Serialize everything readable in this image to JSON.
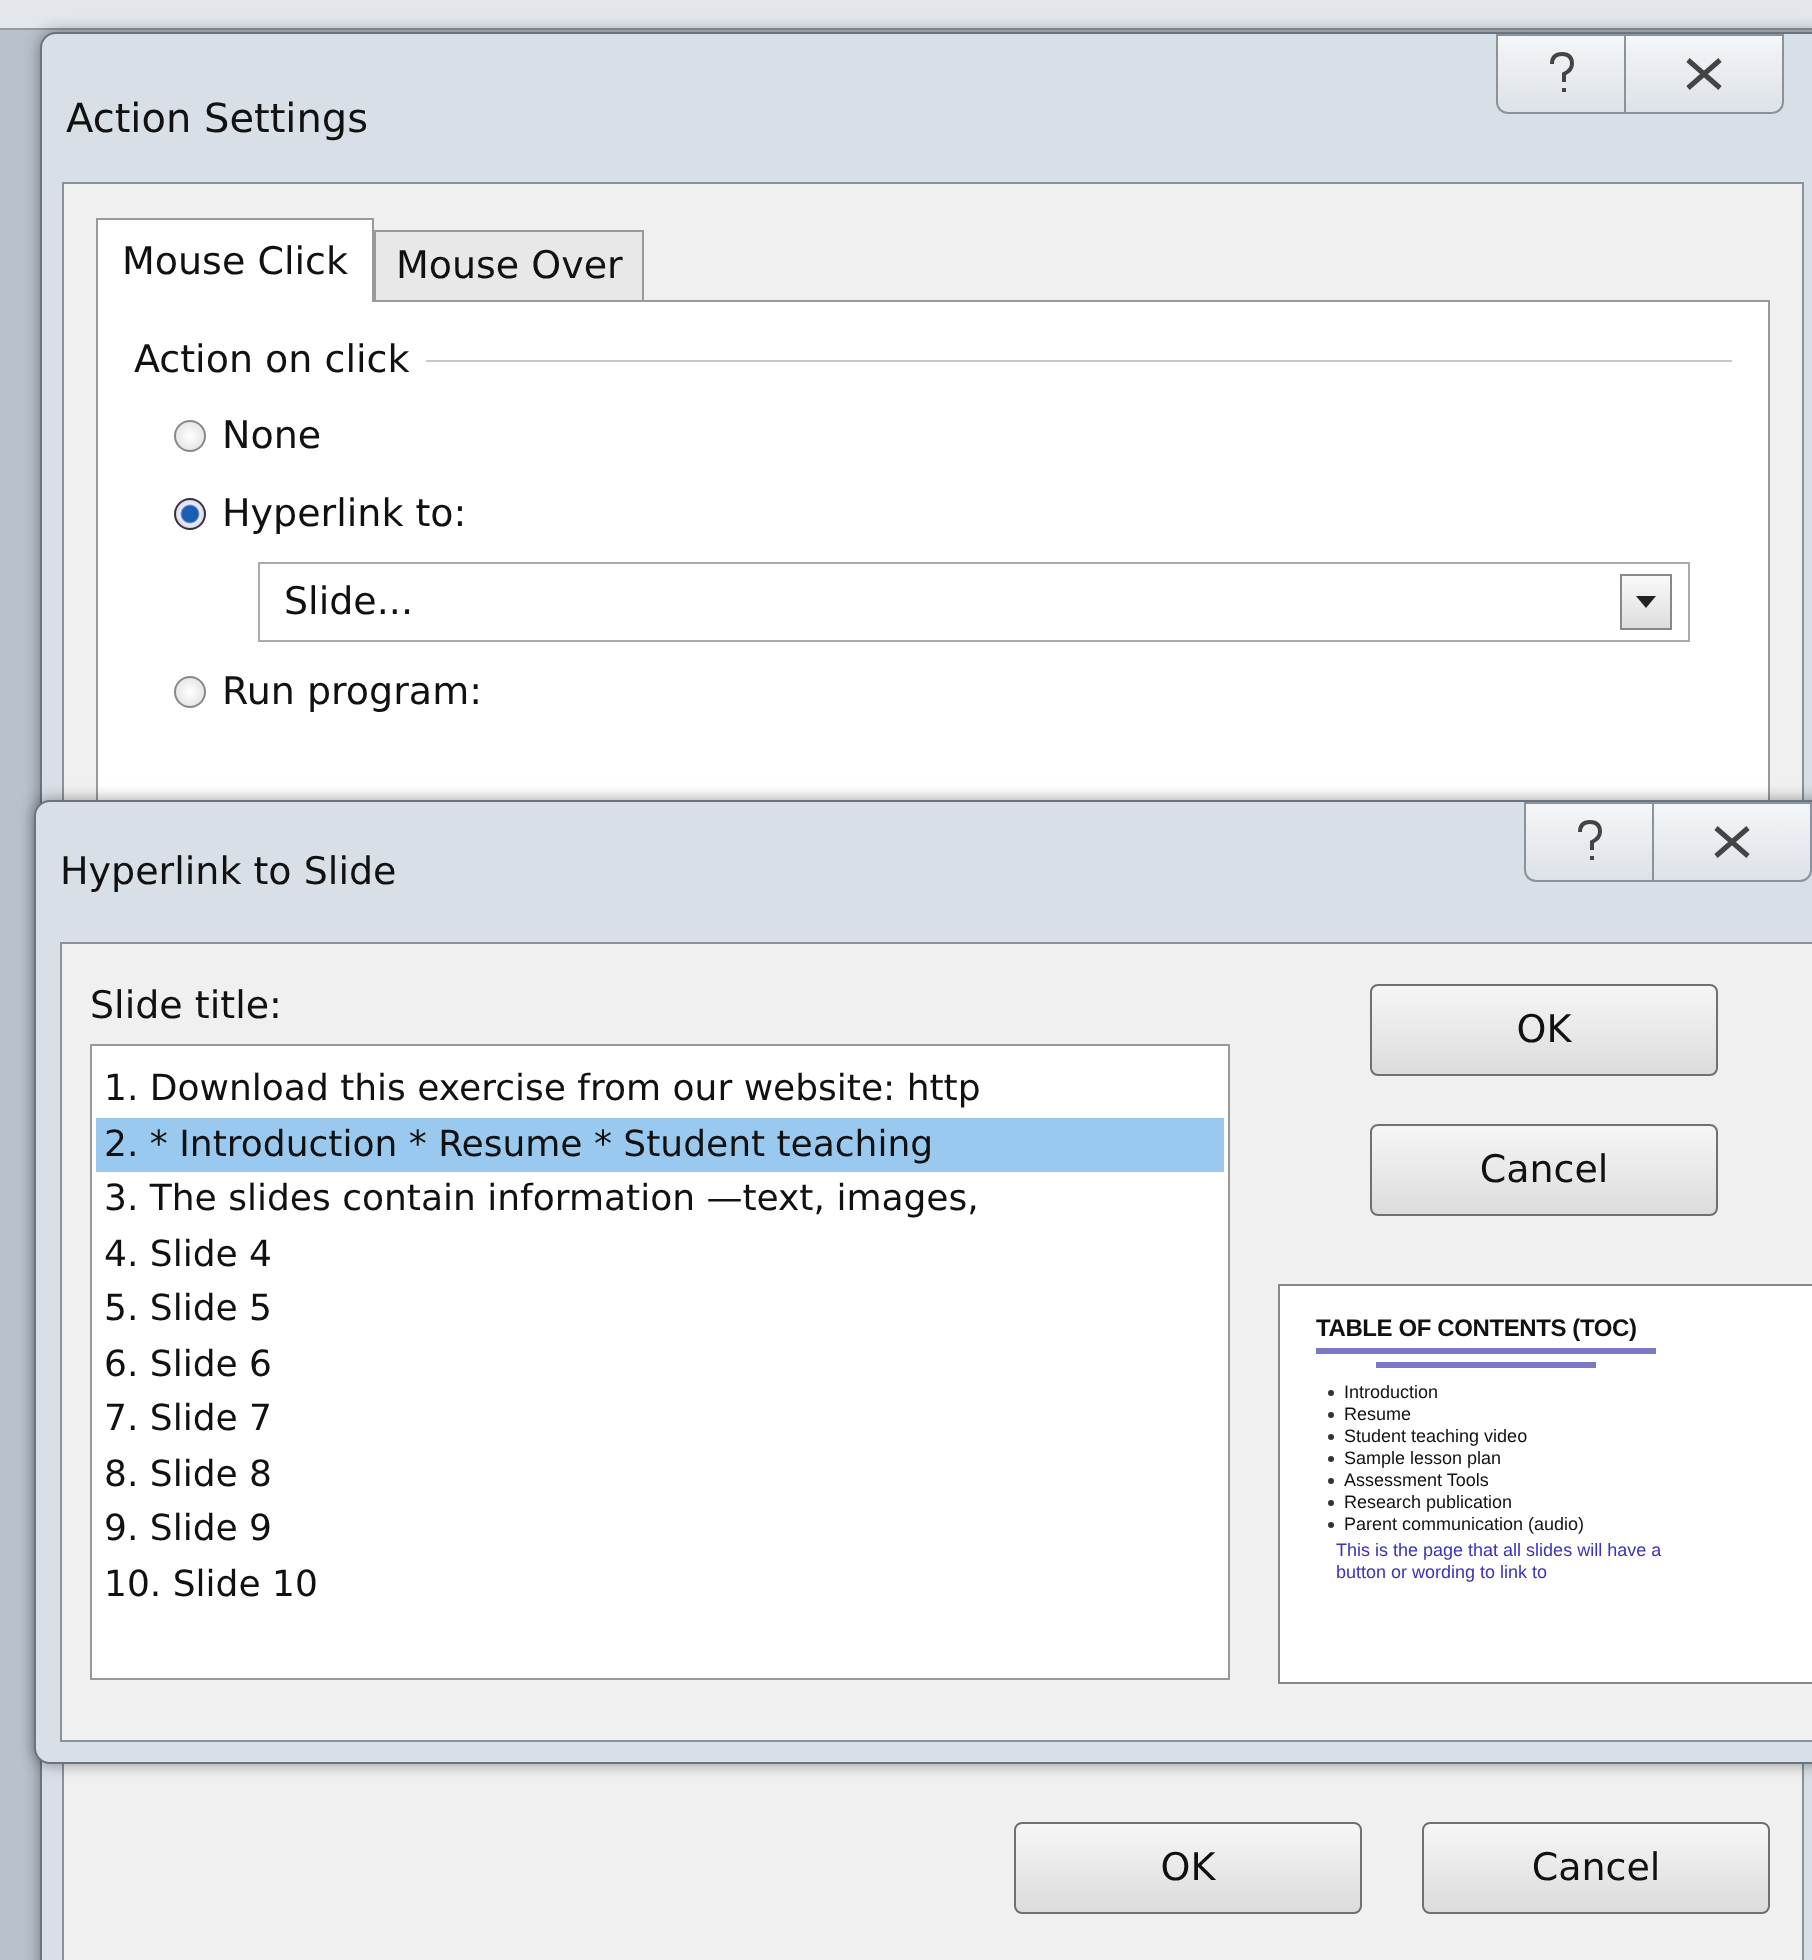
{
  "action_settings": {
    "title": "Action Settings",
    "tabs": [
      {
        "label": "Mouse Click",
        "selected": true
      },
      {
        "label": "Mouse Over",
        "selected": false
      }
    ],
    "group_label": "Action on click",
    "options": [
      {
        "label": "None",
        "selected": false
      },
      {
        "label": "Hyperlink to:",
        "selected": true
      },
      {
        "label": "Run program:",
        "selected": false
      }
    ],
    "dropdown": {
      "value": "Slide..."
    },
    "buttons": [
      "OK",
      "Cancel"
    ]
  },
  "hyperlink_to_slide": {
    "title": "Hyperlink to Slide",
    "list_label": "Slide title:",
    "slides": [
      {
        "label": "1. Download this exercise from our website: http",
        "selected": false
      },
      {
        "label": "2. * Introduction * Resume * Student teaching",
        "selected": true
      },
      {
        "label": "3.  The slides contain information —text, images,",
        "selected": false
      },
      {
        "label": "4. Slide 4",
        "selected": false
      },
      {
        "label": "5. Slide 5",
        "selected": false
      },
      {
        "label": "6. Slide 6",
        "selected": false
      },
      {
        "label": "7. Slide 7",
        "selected": false
      },
      {
        "label": "8. Slide 8",
        "selected": false
      },
      {
        "label": "9. Slide 9",
        "selected": false
      },
      {
        "label": "10. Slide 10",
        "selected": false
      }
    ],
    "buttons": [
      "OK",
      "Cancel"
    ],
    "preview": {
      "title": "TABLE OF  CONTENTS (TOC)",
      "bullets": [
        "Introduction",
        "Resume",
        "Student teaching video",
        "Sample lesson plan",
        "Assessment Tools",
        "Research publication",
        "Parent communication (audio)"
      ],
      "note": "This is the page that all slides will have a button or wording to link to"
    }
  }
}
